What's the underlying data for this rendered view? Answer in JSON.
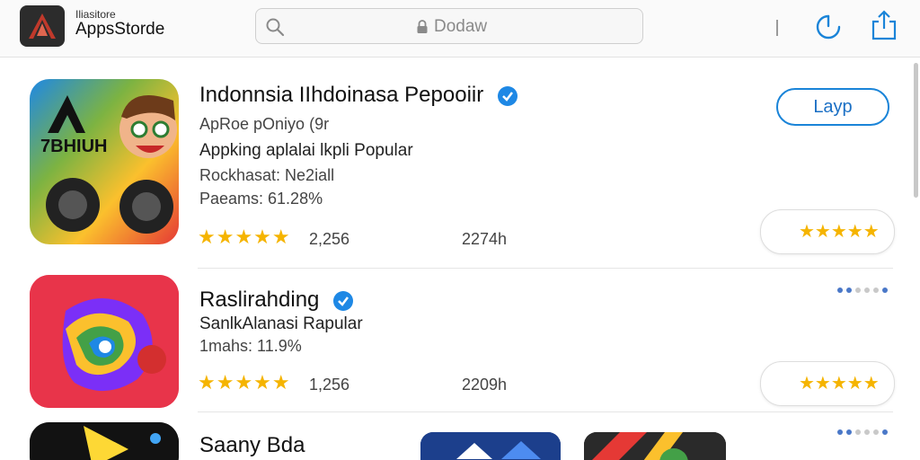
{
  "header": {
    "brand_small": "Iliasitore",
    "brand_main": "AppsStorde",
    "search_placeholder": "Dodaw"
  },
  "apps": [
    {
      "title": "Indonnsia IIhdoinasa Pepooiir",
      "line1": "ApRoe pOniyo (9r",
      "line2": "Appking aplalai lkpli Popular",
      "line3": "Rockhasat: Ne2iall",
      "line4": "Paeams: 61.28%",
      "stars": "★★★★★",
      "count_a": "2,256",
      "count_b": "2274h",
      "action_label": "Layp",
      "pill_stars": "★★★★★",
      "icon_text": "7BHIUH"
    },
    {
      "title": "Raslirahding",
      "line1": "SanlkAlanasi Rapular",
      "line2": "1mahs: 11.9%",
      "stars": "★★★★★",
      "count_a": "1,256",
      "count_b": "2209h",
      "pill_stars": "★★★★★"
    },
    {
      "title": "Saany Bda"
    }
  ],
  "colors": {
    "accent": "#1a84d8",
    "star": "#f5b400",
    "verified": "#1e88e5"
  }
}
